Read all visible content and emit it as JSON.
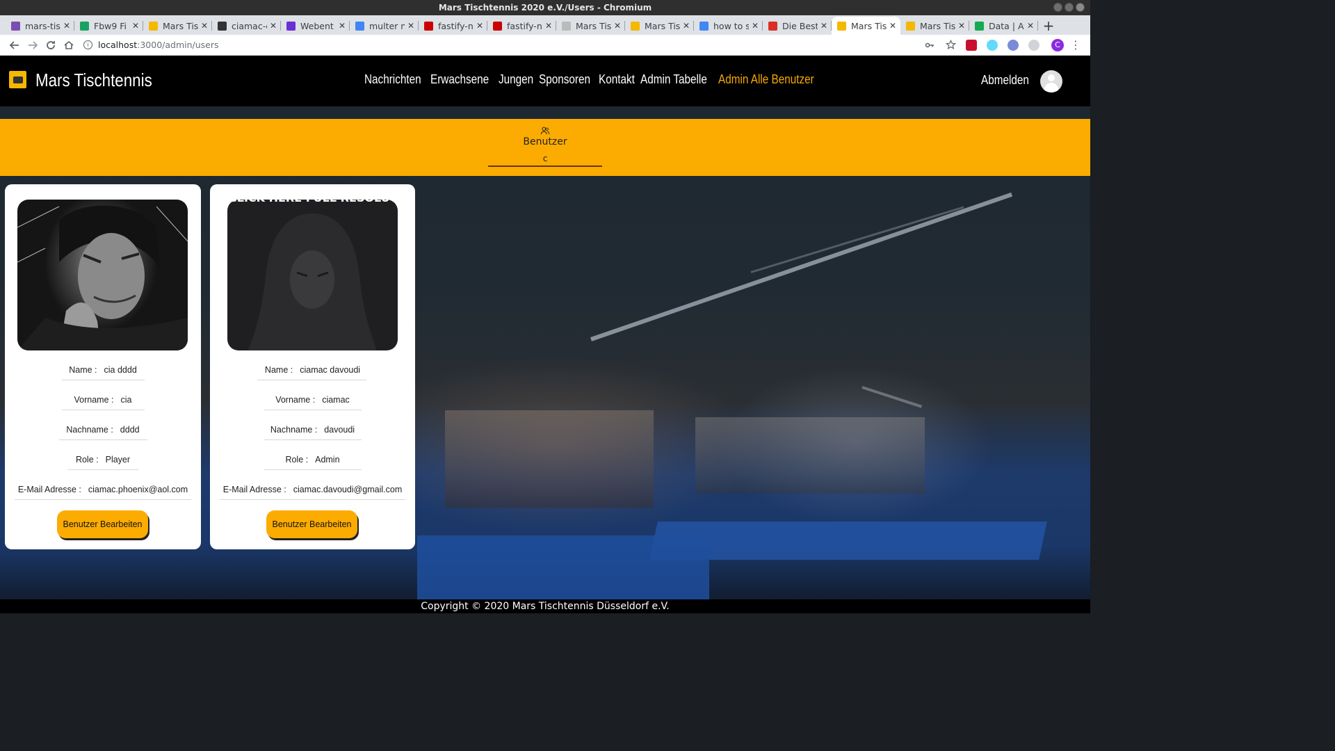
{
  "window": {
    "title": "Mars Tischtennis 2020 e.V./Users - Chromium"
  },
  "tabs": [
    {
      "label": "mars-tis",
      "fav_color": "#7a4db3",
      "fav_icon": "heroku-icon"
    },
    {
      "label": "Fbw9 Fi",
      "fav_color": "#1aa260",
      "fav_icon": "sheets-icon"
    },
    {
      "label": "Mars Tis",
      "fav_color": "#f5b800",
      "fav_icon": "mars-icon"
    },
    {
      "label": "ciamac-c",
      "fav_color": "#333333",
      "fav_icon": "github-icon"
    },
    {
      "label": "Webent",
      "fav_color": "#6b2fd6",
      "fav_icon": "yahoo-icon"
    },
    {
      "label": "multer n",
      "fav_color": "#4285f4",
      "fav_icon": "google-icon"
    },
    {
      "label": "fastify-n",
      "fav_color": "#cb0000",
      "fav_icon": "npm-icon"
    },
    {
      "label": "fastify-n",
      "fav_color": "#cb0000",
      "fav_icon": "npm-icon"
    },
    {
      "label": "Mars Tis",
      "fav_color": "#bbbbbb",
      "fav_icon": "loading-icon"
    },
    {
      "label": "Mars Tis",
      "fav_color": "#f5b800",
      "fav_icon": "mars-icon"
    },
    {
      "label": "how to s",
      "fav_color": "#4285f4",
      "fav_icon": "google-icon"
    },
    {
      "label": "Die Best",
      "fav_color": "#d93025",
      "fav_icon": "gmail-icon"
    },
    {
      "label": "Mars Tis",
      "fav_color": "#f5b800",
      "fav_icon": "mars-icon",
      "active": true
    },
    {
      "label": "Mars Tis",
      "fav_color": "#f5b800",
      "fav_icon": "mars-icon"
    },
    {
      "label": "Data | At",
      "fav_color": "#13aa52",
      "fav_icon": "mongodb-icon"
    }
  ],
  "address": {
    "host": "localhost",
    "path": ":3000/admin/users"
  },
  "profile_initial": "C",
  "site": {
    "brand": "Mars Tischtennis",
    "nav": [
      "Nachrichten",
      "Erwachsene",
      "Jungen",
      "Sponsoren",
      "Kontakt",
      "Admin Tabelle",
      "Admin Alle Benutzer"
    ],
    "active_nav": "Admin Alle Benutzer",
    "logout": "Abmelden",
    "accent": "#fcac00"
  },
  "users_section": {
    "title": "Benutzer",
    "filter_value": "c"
  },
  "labels": {
    "name": "Name :",
    "vorname": "Vorname :",
    "nachname": "Nachname :",
    "role": "Role :",
    "email": "E-Mail Adresse :",
    "edit_button": "Benutzer Bearbeiten"
  },
  "users": [
    {
      "name": "cia dddd",
      "vorname": "cia",
      "nachname": "dddd",
      "role": "Player",
      "email": "ciamac.phoenix@aol.com"
    },
    {
      "name": "ciamac davoudi",
      "vorname": "ciamac",
      "nachname": "davoudi",
      "role": "Admin",
      "email": "ciamac.davoudi@gmail.com",
      "image_caption": "CLICK HERE FULL RESOLUTION"
    }
  ],
  "footer": "Copyright © 2020  Mars Tischtennis Düsseldorf e.V."
}
